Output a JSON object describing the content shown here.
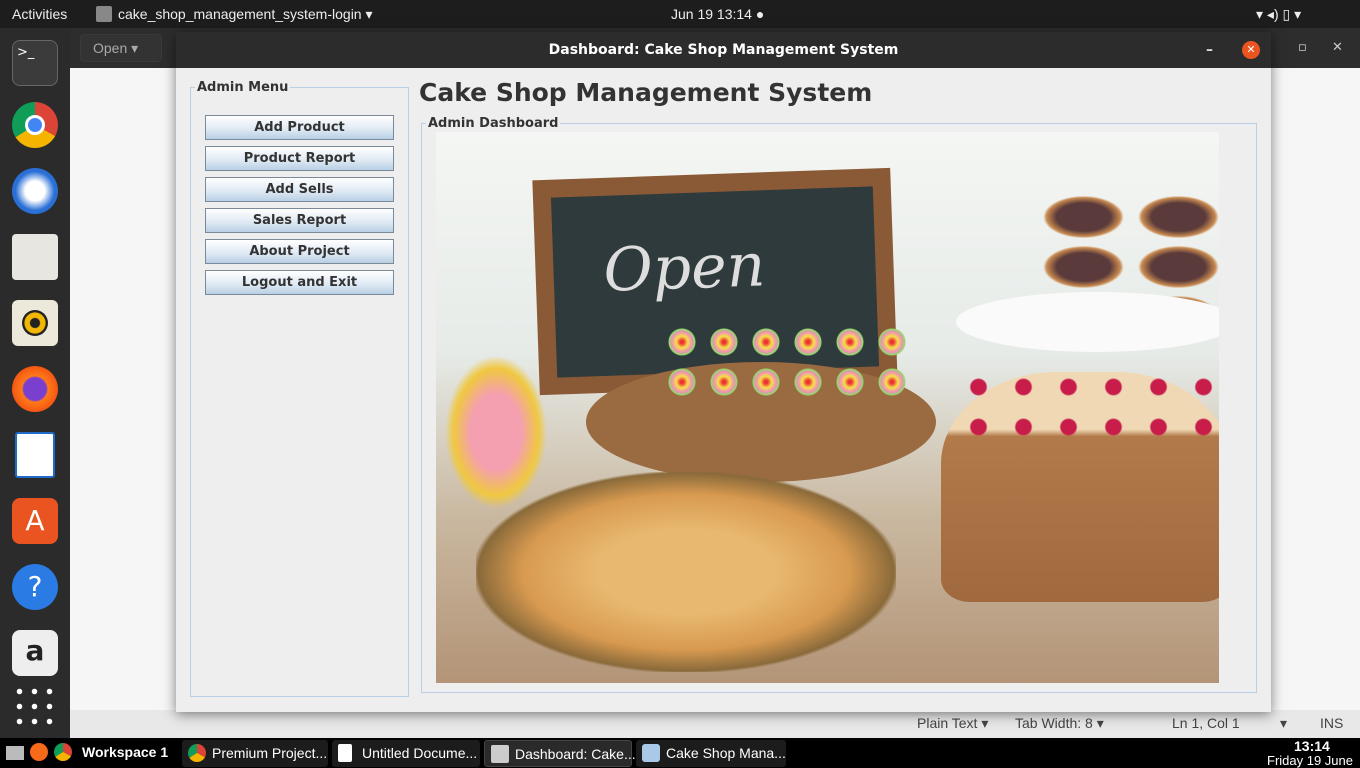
{
  "topbar": {
    "activities": "Activities",
    "app": "cake_shop_management_system-login ▾",
    "clock": "Jun 19  13:14 ●",
    "tray": "▾ ◂) ▯ ▾"
  },
  "editor": {
    "open": "Open ▾",
    "status": {
      "lang": "Plain Text ▾",
      "tab": "Tab Width: 8 ▾",
      "pos": "Ln 1, Col 1",
      "arrow": "▾",
      "ins": "INS"
    },
    "controls": {
      "min": "—",
      "max": "▫",
      "close": "✕"
    }
  },
  "window": {
    "title": "Dashboard: Cake Shop Management System",
    "min": "–",
    "close": "✕",
    "menu_legend": "Admin Menu",
    "buttons": [
      "Add Product",
      "Product Report",
      "Add Sells",
      "Sales Report",
      "About Project",
      "Logout and Exit"
    ],
    "app_title": "Cake Shop Management System",
    "dash_legend": "Admin Dashboard",
    "chalk": "Open"
  },
  "taskbar": {
    "workspace": "Workspace 1",
    "tasks": [
      "Premium Project...",
      "Untitled Docume...",
      "Dashboard: Cake...",
      "Cake Shop Mana..."
    ],
    "time": "13:14",
    "date": "Friday 19 June"
  }
}
